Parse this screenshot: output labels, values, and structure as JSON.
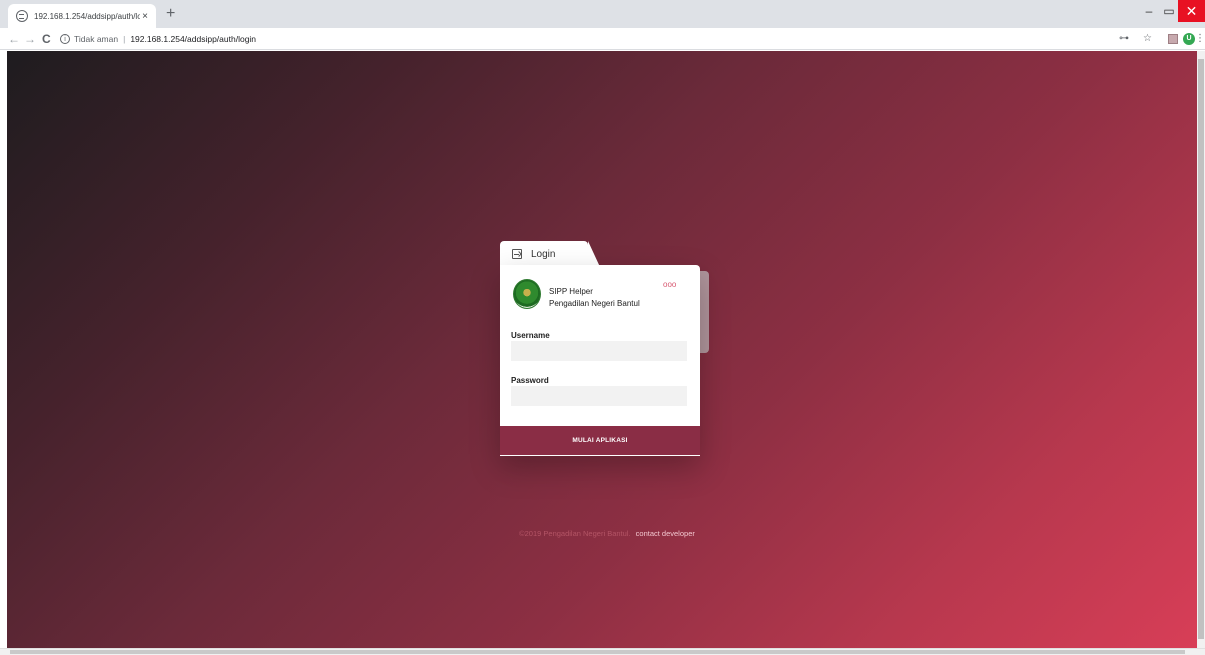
{
  "browser": {
    "tab_title": "192.168.1.254/addsipp/auth/logi",
    "tab_close": "×",
    "new_tab": "+",
    "security_label": "Tidak aman",
    "separator": "|",
    "url": "192.168.1.254/addsipp/auth/login",
    "avatar_initial": "U",
    "window_controls": {
      "minimize": "–",
      "maximize": "▭",
      "close": "✕"
    }
  },
  "login": {
    "tab_label": "Login",
    "app_name": "SIPP Helper",
    "org_name": "Pengadilan Negeri Bantul",
    "username_label": "Username",
    "username_value": "",
    "password_label": "Password",
    "password_value": "",
    "submit_label": "MULAI APLIKASI",
    "menu_dots": "ooo"
  },
  "footer": {
    "copyright": "©2019 Pengadilan Negeri Bantul.",
    "link": "contact developer"
  },
  "colors": {
    "gradient_start": "#1e1c1f",
    "gradient_end": "#d83e57",
    "button": "#8a2d45",
    "accent": "#d85a72"
  }
}
